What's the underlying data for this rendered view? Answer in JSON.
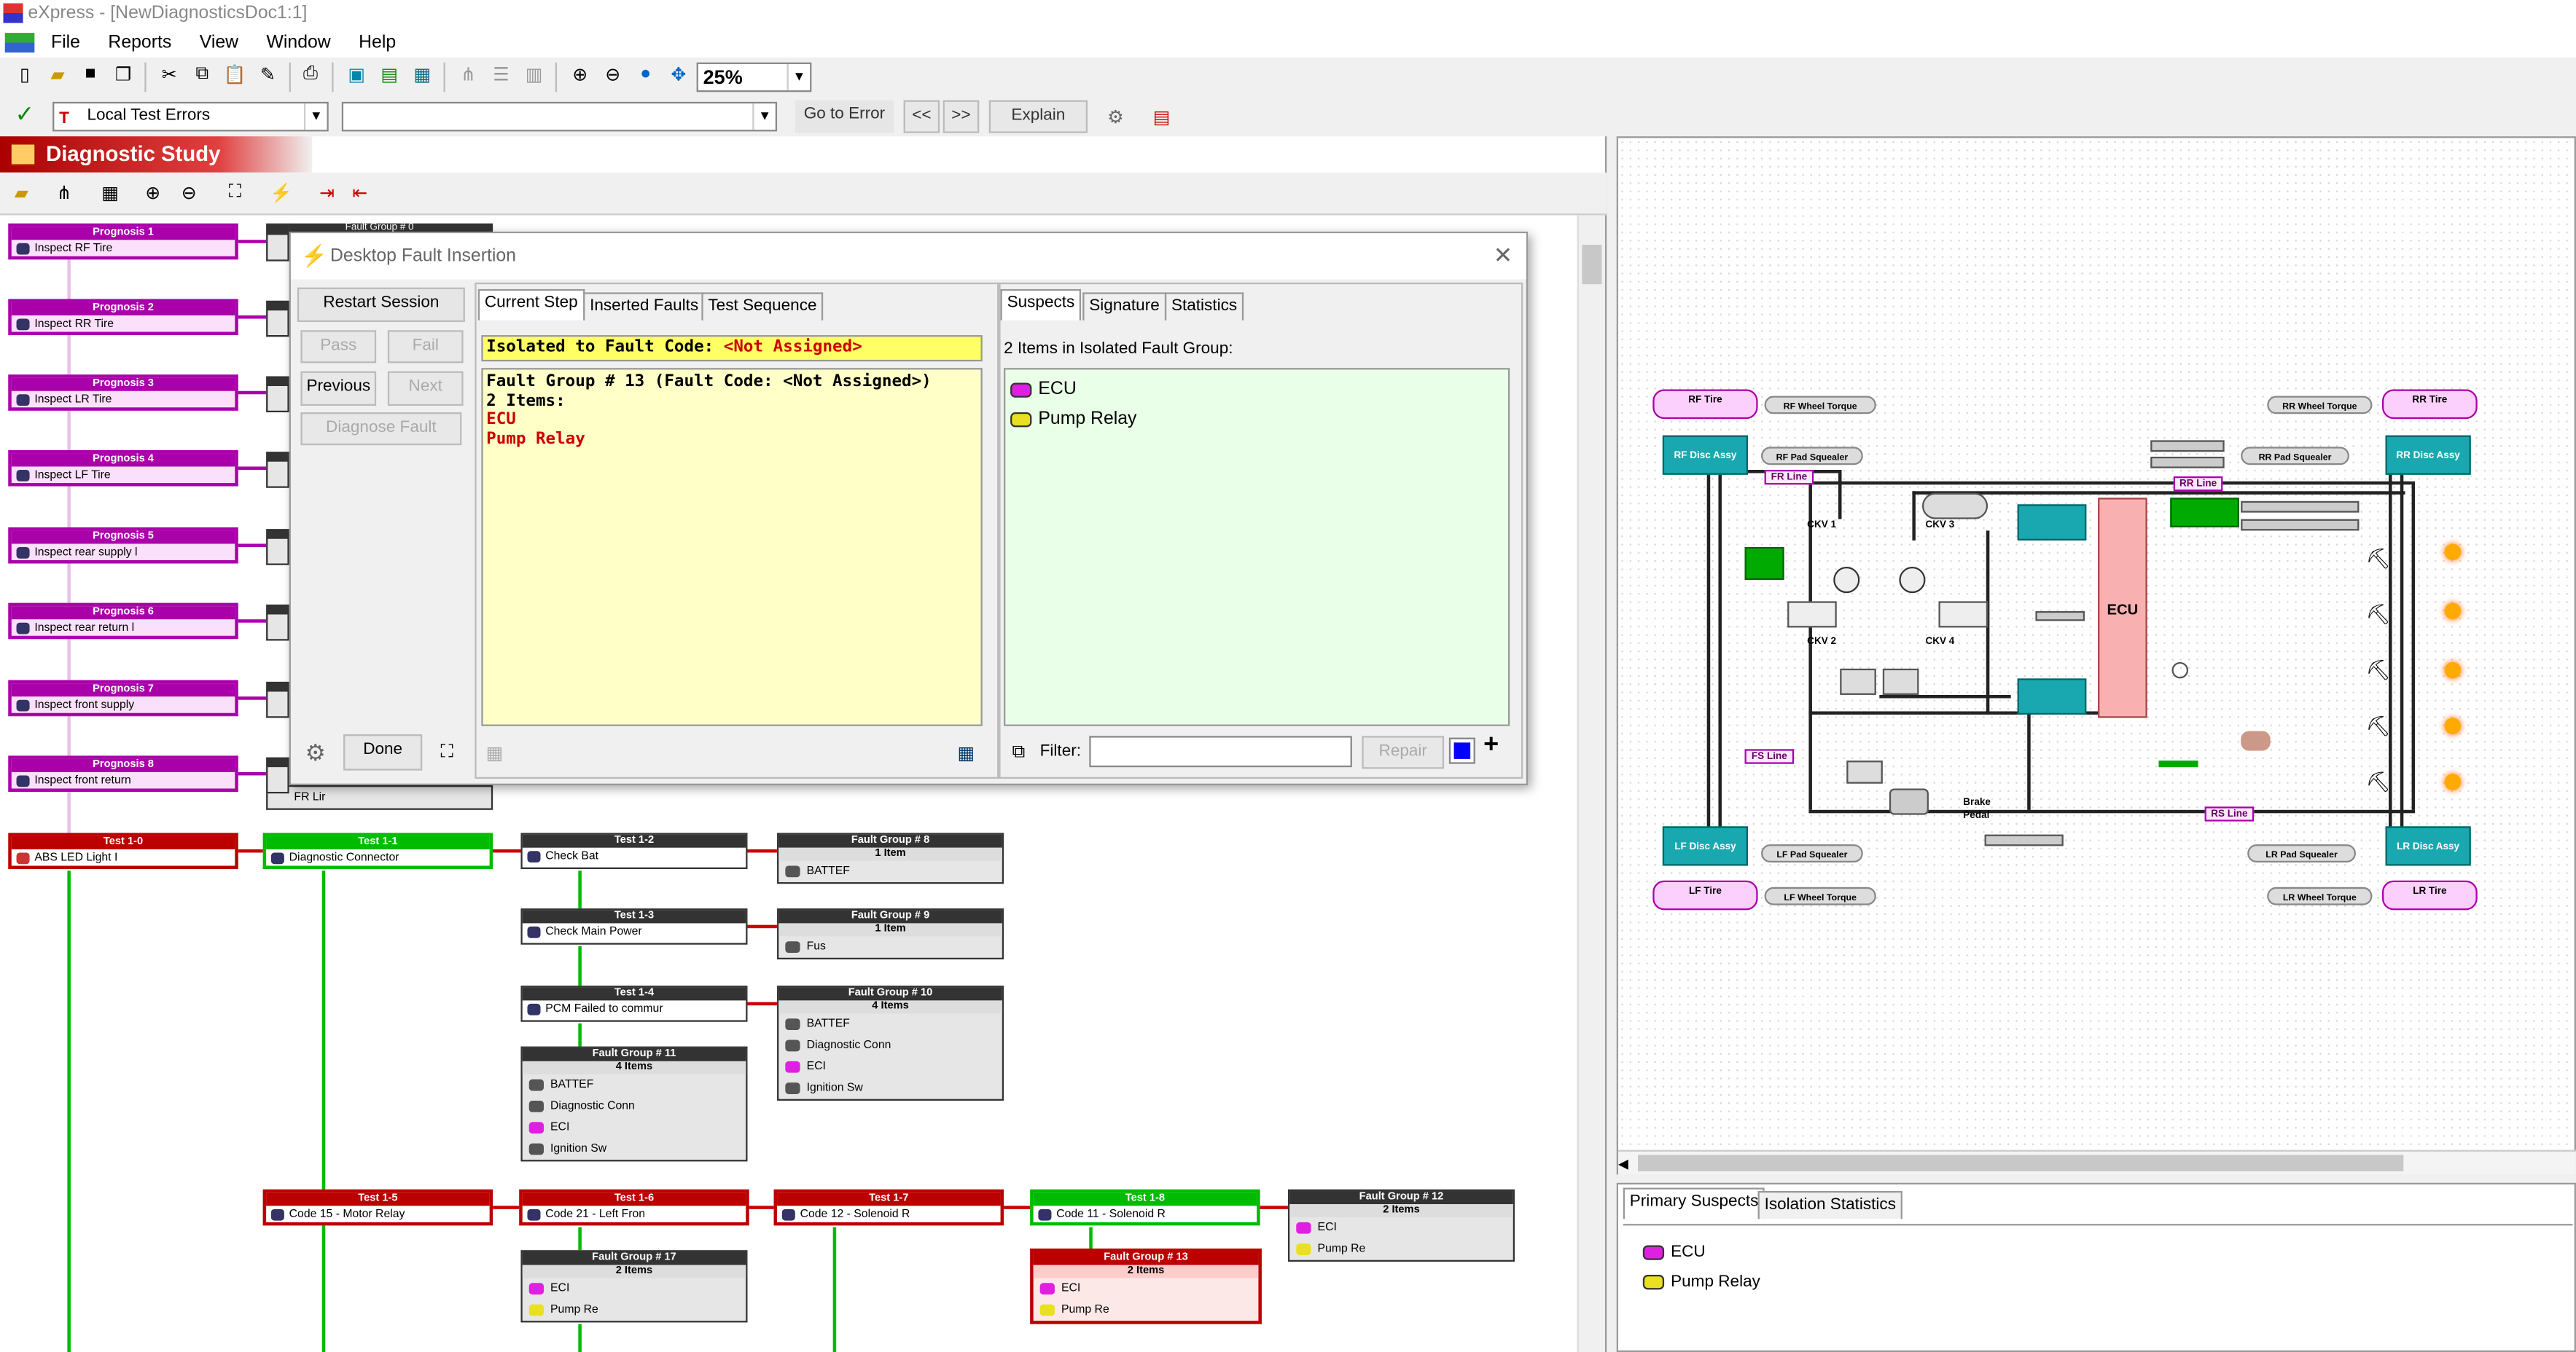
{
  "window": {
    "title": "eXpress - [NewDiagnosticsDoc1:1]"
  },
  "menu": [
    "File",
    "Reports",
    "View",
    "Window",
    "Help"
  ],
  "toolbar": {
    "zoom_value": "25%"
  },
  "toolbar2": {
    "error_filter": "Local Test Errors",
    "second_combo": "",
    "go_to_error": "Go to Error",
    "prev": "<<",
    "next": ">>",
    "explain": "Explain"
  },
  "study": {
    "title": "Diagnostic Study"
  },
  "prognoses": [
    {
      "header": "Prognosis 1",
      "label": "Inspect RF Tire"
    },
    {
      "header": "Prognosis 2",
      "label": "Inspect RR Tire"
    },
    {
      "header": "Prognosis 3",
      "label": "Inspect LR Tire"
    },
    {
      "header": "Prognosis 4",
      "label": "Inspect LF Tire"
    },
    {
      "header": "Prognosis 5",
      "label": "Inspect rear supply l"
    },
    {
      "header": "Prognosis 6",
      "label": "Inspect rear return l"
    },
    {
      "header": "Prognosis 7",
      "label": "Inspect front supply"
    },
    {
      "header": "Prognosis 8",
      "label": "Inspect front return"
    }
  ],
  "fg0_header": "Fault Group # 0",
  "fg0_last_item": "FR Lir",
  "tests": {
    "t10": {
      "header": "Test 1-0",
      "label": "ABS LED Light I"
    },
    "t11": {
      "header": "Test 1-1",
      "label": "Diagnostic Connector"
    },
    "t12": {
      "header": "Test 1-2",
      "label": "Check Bat"
    },
    "t13": {
      "header": "Test 1-3",
      "label": "Check Main Power"
    },
    "t14": {
      "header": "Test 1-4",
      "label": "PCM Failed to commur"
    },
    "t15": {
      "header": "Test 1-5",
      "label": "Code 15 - Motor Relay"
    },
    "t16": {
      "header": "Test 1-6",
      "label": "Code 21 - Left Fron"
    },
    "t17": {
      "header": "Test 1-7",
      "label": "Code 12 - Solenoid R"
    },
    "t18": {
      "header": "Test 1-8",
      "label": "Code 11 - Solenoid R"
    }
  },
  "fault_groups": {
    "fg8": {
      "header": "Fault Group # 8",
      "count": "1 Item",
      "items": [
        "BATTEF"
      ]
    },
    "fg9": {
      "header": "Fault Group # 9",
      "count": "1 Item",
      "items": [
        "Fus"
      ]
    },
    "fg10": {
      "header": "Fault Group # 10",
      "count": "4 Items",
      "items": [
        "BATTEF",
        "Diagnostic Conn",
        "ECI",
        "Ignition Sw"
      ]
    },
    "fg11": {
      "header": "Fault Group # 11",
      "count": "4 Items",
      "items": [
        "BATTEF",
        "Diagnostic Conn",
        "ECI",
        "Ignition Sw"
      ]
    },
    "fg12": {
      "header": "Fault Group # 12",
      "count": "2 Items",
      "items": [
        "ECI",
        "Pump Re"
      ]
    },
    "fg13": {
      "header": "Fault Group # 13",
      "count": "2 Items",
      "items": [
        "ECI",
        "Pump Re"
      ]
    },
    "fg17": {
      "header": "Fault Group # 17",
      "count": "2 Items",
      "items": [
        "ECI",
        "Pump Re"
      ]
    }
  },
  "dialog": {
    "title": "Desktop Fault Insertion",
    "restart": "Restart Session",
    "pass": "Pass",
    "fail": "Fail",
    "previous": "Previous",
    "next": "Next",
    "diagnose": "Diagnose Fault",
    "done": "Done",
    "tabs_left": [
      "Current Step",
      "Inserted Faults",
      "Test Sequence"
    ],
    "tabs_right": [
      "Suspects",
      "Signature",
      "Statistics"
    ],
    "isolated_prefix": "Isolated to Fault Code: ",
    "isolated_value": "<Not Assigned>",
    "step_line1": "Fault Group # 13 (Fault Code: <Not Assigned>)",
    "step_line2": "2 Items:",
    "step_items": [
      "ECU",
      "Pump Relay"
    ],
    "suspects_caption": "2 Items in Isolated Fault Group:",
    "suspects": [
      {
        "name": "ECU",
        "color": "#e020e0"
      },
      {
        "name": "Pump Relay",
        "color": "#e8e020"
      }
    ],
    "filter_label": "Filter:",
    "filter_value": "",
    "repair": "Repair",
    "plus": "+"
  },
  "schematic": {
    "rf_tire": "RF Tire",
    "rf_wheel_torque": "RF Wheel Torque",
    "rf_disc": "RF Disc Assy",
    "rf_pad": "RF Pad Squealer",
    "rr_tire": "RR Tire",
    "rr_wheel_torque": "RR Wheel Torque",
    "rr_disc": "RR Disc Assy",
    "rr_pad": "RR Pad Squealer",
    "lf_tire": "LF Tire",
    "lf_wheel_torque": "LF Wheel Torque",
    "lf_disc": "LF Disc Assy",
    "lf_pad": "LF Pad Squealer",
    "lr_tire": "LR Tire",
    "lr_wheel_torque": "LR Wheel Torque",
    "lr_disc": "LR Disc Assy",
    "lr_pad": "LR Pad Squealer",
    "fr_line": "FR Line",
    "rr_line": "RR Line",
    "fs_line": "FS Line",
    "rs_line": "RS Line",
    "ckv1": "CKV 1",
    "ckv2": "CKV 2",
    "ckv3": "CKV 3",
    "ckv4": "CKV 4",
    "ecu": "ECU",
    "brake_pedal": "Brake\nPedal"
  },
  "bottom": {
    "tabs": [
      "Primary Suspects",
      "Isolation Statistics"
    ],
    "items": [
      {
        "name": "ECU",
        "color": "#e020e0"
      },
      {
        "name": "Pump Relay",
        "color": "#e8e020"
      }
    ]
  }
}
